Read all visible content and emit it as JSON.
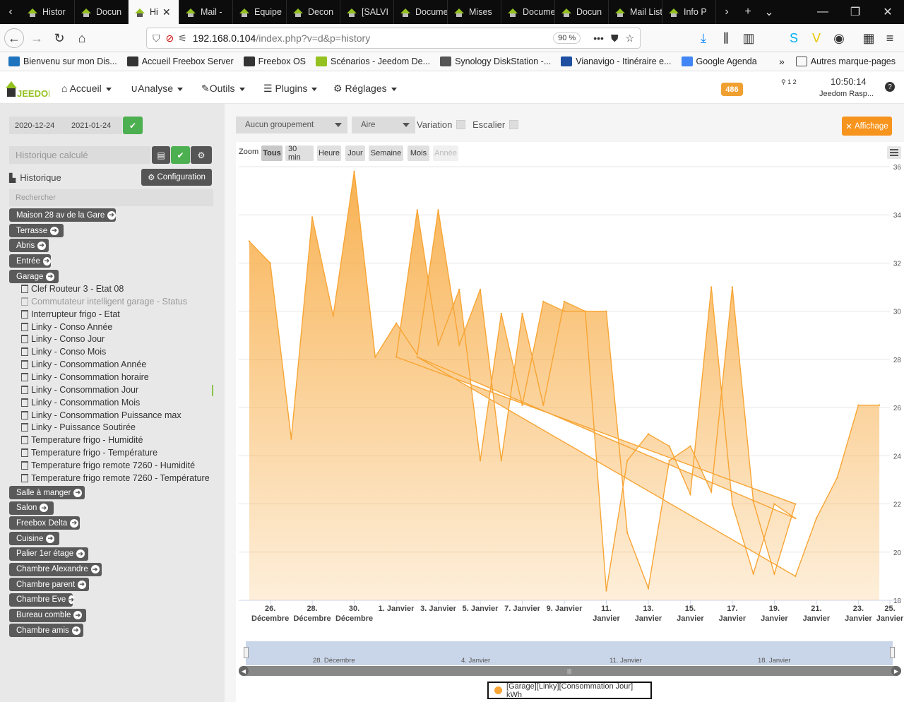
{
  "browser": {
    "tabs": [
      {
        "label": "Histor"
      },
      {
        "label": "Docun"
      },
      {
        "label": "Hi",
        "active": true
      },
      {
        "label": "Mail -"
      },
      {
        "label": "Equipe"
      },
      {
        "label": "Decon"
      },
      {
        "label": "[SALVI"
      },
      {
        "label": "Document"
      },
      {
        "label": "Mises"
      },
      {
        "label": "Document"
      },
      {
        "label": "Docun"
      },
      {
        "label": "Mail Listen"
      },
      {
        "label": "Info P"
      }
    ],
    "url_host": "192.168.0.104",
    "url_path": "/index.php?v=d&p=history",
    "zoom": "90 %",
    "bookmarks": [
      {
        "label": "Bienvenu sur mon Dis...",
        "icon": "dsm-icon"
      },
      {
        "label": "Accueil Freebox Server",
        "icon": "freebox-icon"
      },
      {
        "label": "Freebox OS",
        "icon": "freebox-icon"
      },
      {
        "label": "Scénarios - Jeedom De...",
        "icon": "jeedom-icon"
      },
      {
        "label": "Synology DiskStation -...",
        "icon": "globe-icon"
      },
      {
        "label": "Vianavigo - Itinéraire e...",
        "icon": "arrow-icon"
      },
      {
        "label": "Google Agenda",
        "icon": "google-icon"
      }
    ],
    "other_bookmarks": "Autres marque-pages"
  },
  "header": {
    "logo": "JEEDOM",
    "menus": [
      "Accueil",
      "Analyse",
      "Outils",
      "Plugins",
      "Réglages"
    ],
    "badge": "486",
    "time": "10:50:14",
    "host": "Jeedom Rasp...",
    "counters": "1  2"
  },
  "left": {
    "date_start": "2020-12-24",
    "date_end": "2021-01-24",
    "calc_placeholder": "Historique calculé",
    "history_title": "Historique",
    "config_button": "Configuration",
    "search_placeholder": "Rechercher",
    "objects_top": [
      "Maison 28 av de la Gare",
      "Terrasse",
      "Abris",
      "Entrée",
      "Garage"
    ],
    "commands": [
      {
        "label": "Clef Routeur 3 - Etat 08",
        "dim": false
      },
      {
        "label": "Commutateur intelligent garage - Status",
        "dim": true
      },
      {
        "label": "Interrupteur frigo - Etat",
        "dim": false
      },
      {
        "label": "Linky - Conso Année",
        "dim": false
      },
      {
        "label": "Linky - Conso Jour",
        "dim": false
      },
      {
        "label": "Linky - Conso Mois",
        "dim": false
      },
      {
        "label": "Linky - Consommation Année",
        "dim": false
      },
      {
        "label": "Linky - Consommation horaire",
        "dim": false
      },
      {
        "label": "Linky - Consommation Jour",
        "dim": false
      },
      {
        "label": "Linky - Consommation Mois",
        "dim": false
      },
      {
        "label": "Linky - Consommation Puissance max",
        "dim": false
      },
      {
        "label": "Linky - Puissance Soutirée",
        "dim": false
      },
      {
        "label": "Temperature frigo - Humidité",
        "dim": false
      },
      {
        "label": "Temperature frigo - Température",
        "dim": false
      },
      {
        "label": "Temperature frigo remote 7260 - Humidité",
        "dim": false
      },
      {
        "label": "Temperature frigo remote 7260 - Température",
        "dim": false
      }
    ],
    "objects_bottom": [
      "Salle à manger",
      "Salon",
      "Freebox Delta",
      "Cuisine",
      "Palier 1er étage",
      "Chambre Alexandre",
      "Chambre parent",
      "Chambre Eve",
      "Bureau comble",
      "Chambre amis"
    ]
  },
  "toolbar": {
    "grouping": "Aucun groupement",
    "chart_type": "Aire",
    "variation": "Variation",
    "stairs": "Escalier",
    "affichage": "Affichage"
  },
  "zoom": {
    "label": "Zoom",
    "buttons": [
      "Tous",
      "30 min",
      "Heure",
      "Jour",
      "Semaine",
      "Mois",
      "Année"
    ],
    "selected": "Tous",
    "disabled": "Année"
  },
  "chart_data": {
    "type": "area",
    "color": "#f7a535",
    "ylim": [
      18,
      36
    ],
    "yticks": [
      18,
      20,
      22,
      24,
      26,
      28,
      30,
      32,
      34,
      36
    ],
    "xlim": [
      0,
      31
    ],
    "xticks": [
      {
        "x": 1.5,
        "l1": "26.",
        "l2": "Décembre"
      },
      {
        "x": 3.5,
        "l1": "28.",
        "l2": "Décembre"
      },
      {
        "x": 5.5,
        "l1": "30.",
        "l2": "Décembre"
      },
      {
        "x": 7.5,
        "l1": "1. Janvier",
        "l2": ""
      },
      {
        "x": 9.5,
        "l1": "3. Janvier",
        "l2": ""
      },
      {
        "x": 11.5,
        "l1": "5. Janvier",
        "l2": ""
      },
      {
        "x": 13.5,
        "l1": "7. Janvier",
        "l2": ""
      },
      {
        "x": 15.5,
        "l1": "9. Janvier",
        "l2": ""
      },
      {
        "x": 17.5,
        "l1": "11.",
        "l2": "Janvier"
      },
      {
        "x": 19.5,
        "l1": "13.",
        "l2": "Janvier"
      },
      {
        "x": 21.5,
        "l1": "15.",
        "l2": "Janvier"
      },
      {
        "x": 23.5,
        "l1": "17.",
        "l2": "Janvier"
      },
      {
        "x": 25.5,
        "l1": "19.",
        "l2": "Janvier"
      },
      {
        "x": 27.5,
        "l1": "21.",
        "l2": "Janvier"
      },
      {
        "x": 29.5,
        "l1": "23.",
        "l2": "Janvier"
      },
      {
        "x": 31.0,
        "l1": "25.",
        "l2": "Janvier"
      }
    ],
    "series": [
      {
        "name": "[Garage][Linky][Consommation Jour] kWh",
        "x": [
          0.5,
          1.5,
          2.5,
          3.5,
          4.5,
          5.5,
          6.5,
          7.5,
          8.5,
          9.5,
          10.5,
          11.5,
          12.5,
          13.5,
          14.5,
          15.5,
          16.5,
          17.5,
          18.5,
          19.5,
          20.5,
          21.5,
          22.5,
          23.5,
          24.5,
          25.5,
          26.5,
          7.5,
          8.5,
          9.5,
          10.5,
          11.5,
          12.5,
          13.5,
          14.5,
          15.5,
          16.5,
          17.5,
          18.5,
          19.5,
          20.5,
          21.5,
          22.5,
          23.5,
          24.5,
          25.5,
          26.5,
          8.5,
          26.5,
          27.5,
          28.5,
          29.5,
          30.5
        ],
        "y": [
          32.9,
          32.0,
          24.7,
          33.9,
          29.8,
          35.8,
          28.1,
          29.5,
          28.2,
          34.2,
          28.6,
          30.9,
          23.8,
          29.9,
          26.1,
          30.4,
          30.0,
          30.0,
          20.8,
          18.5,
          23.8,
          24.4,
          22.5,
          31.0,
          22.1,
          19.1,
          22.0,
          28.1,
          34.2,
          28.6,
          30.9,
          23.8,
          29.9,
          26.1,
          30.4,
          30.0,
          30.0,
          18.4,
          23.8,
          24.9,
          24.4,
          22.4,
          31.0,
          22.0,
          19.1,
          22.0,
          21.4,
          28.1,
          19.0,
          21.4,
          23.1,
          26.1,
          26.1
        ]
      }
    ]
  },
  "navigator": {
    "labels": [
      "28. Décembre",
      "4. Janvier",
      "11. Janvier",
      "18. Janvier"
    ]
  },
  "legend": {
    "label": "[Garage][Linky][Consommation Jour] kWh"
  }
}
